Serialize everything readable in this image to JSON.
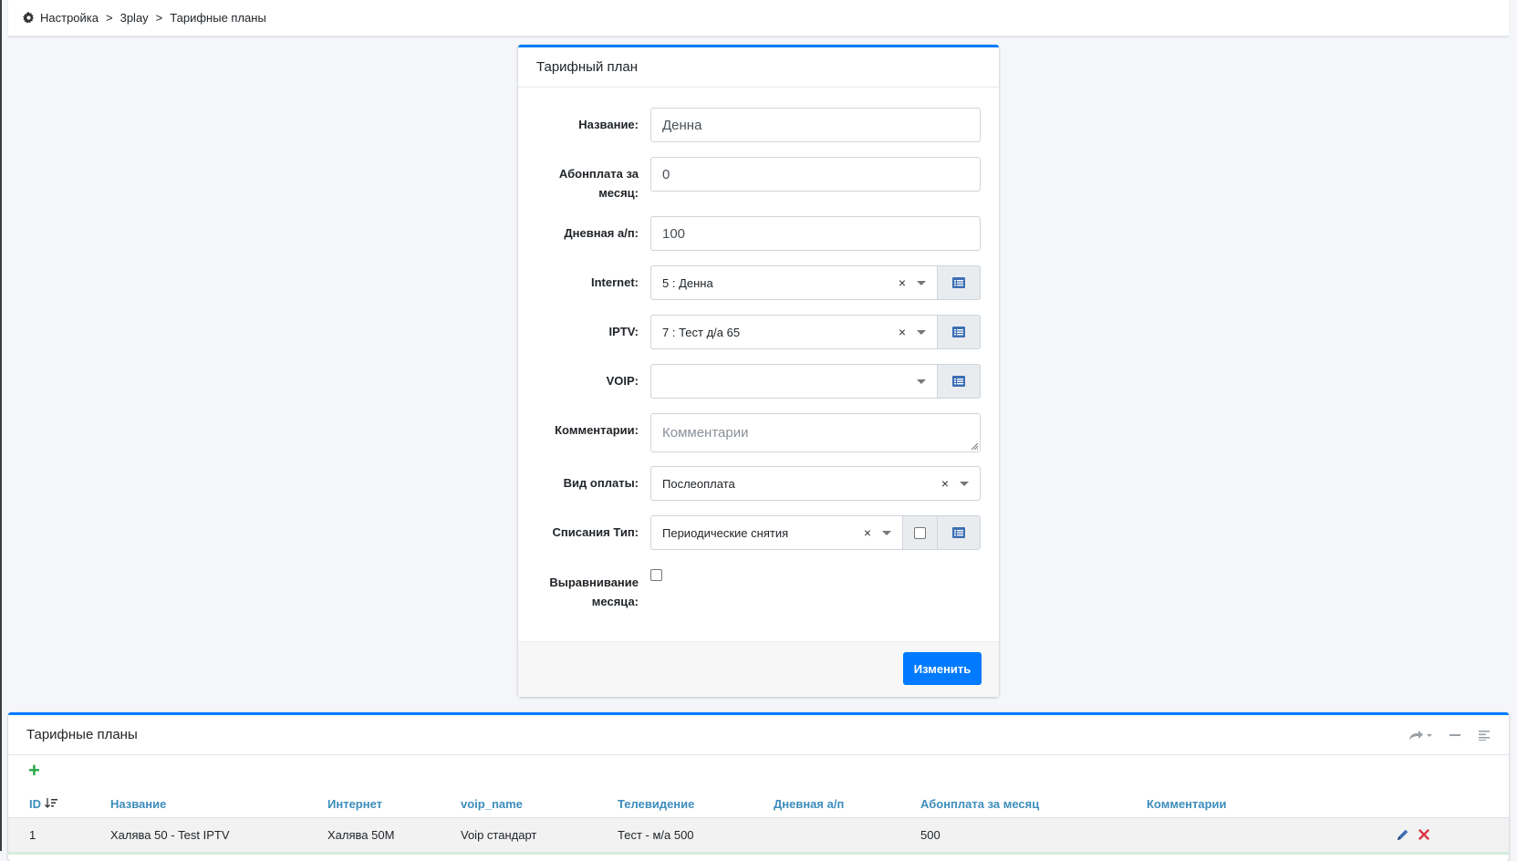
{
  "breadcrumb": {
    "items": [
      "Настройка",
      "3play",
      "Тарифные планы"
    ],
    "separator": ">"
  },
  "form": {
    "title": "Тарифный план",
    "fields": {
      "name": {
        "label": "Название:",
        "value": "Денна"
      },
      "monthly": {
        "label": "Абонплата за месяц:",
        "value": "0"
      },
      "daily": {
        "label": "Дневная а/п:",
        "value": "100"
      },
      "internet": {
        "label": "Internet:",
        "value": "5 : Денна"
      },
      "iptv": {
        "label": "IPTV:",
        "value": "7 : Тест д/а 65"
      },
      "voip": {
        "label": "VOIP:",
        "value": ""
      },
      "comments": {
        "label": "Комментарии:",
        "placeholder": "Комментарии"
      },
      "payment_type": {
        "label": "Вид оплаты:",
        "value": "Послеоплата"
      },
      "charge_type": {
        "label": "Списания Тип:",
        "value": "Периодические снятия"
      },
      "month_align": {
        "label": "Выравнивание месяца:"
      }
    },
    "clear_glyph": "×",
    "submit_label": "Изменить"
  },
  "table": {
    "title": "Тарифные планы",
    "add_glyph": "+",
    "columns": [
      "ID",
      "Название",
      "Интернет",
      "voip_name",
      "Телевидение",
      "Дневная а/п",
      "Абонплата за месяц",
      "Комментарии"
    ],
    "rows": [
      {
        "id": "1",
        "name": "Халява 50 - Test IPTV",
        "internet": "Халява 50M",
        "voip": "Voip стандарт",
        "tv": "Тест - м/а 500",
        "daily": "",
        "monthly": "500",
        "comments": ""
      }
    ]
  },
  "colors": {
    "accent": "#007bff",
    "link": "#3c8dbc",
    "add": "#28a745",
    "delete": "#dc3545"
  }
}
